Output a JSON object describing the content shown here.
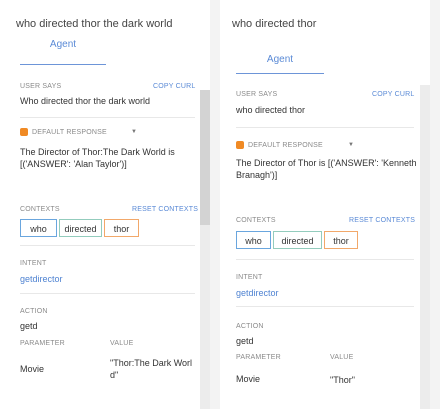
{
  "left": {
    "query": "who directed thor the dark world",
    "tab_label": "Agent",
    "user_says_label": "USER SAYS",
    "copy_curl_label": "COPY CURL",
    "user_says_value": "Who directed thor the dark world",
    "default_response_label": "DEFAULT RESPONSE",
    "response_line1": "The Director of Thor:The Dark World is",
    "response_line2": "[('ANSWER': 'Alan Taylor')]",
    "contexts_label": "CONTEXTS",
    "reset_contexts_label": "RESET CONTEXTS",
    "contexts": [
      "who",
      "directed",
      "thor"
    ],
    "intent_label": "INTENT",
    "intent_value": "getdirector",
    "action_label": "ACTION",
    "action_value": "getd",
    "parameter_header": "PARAMETER",
    "value_header": "VALUE",
    "parameter_name": "Movie",
    "parameter_value_line1": "\"Thor:The Dark Worl",
    "parameter_value_line2": "d\""
  },
  "right": {
    "query": "who directed thor",
    "tab_label": "Agent",
    "user_says_label": "USER SAYS",
    "copy_curl_label": "COPY CURL",
    "user_says_value": "who directed thor",
    "default_response_label": "DEFAULT RESPONSE",
    "response_line1": "The Director of Thor is [('ANSWER': 'Kenneth",
    "response_line2": "Branagh')]",
    "contexts_label": "CONTEXTS",
    "reset_contexts_label": "RESET CONTEXTS",
    "contexts": [
      "who",
      "directed",
      "thor"
    ],
    "intent_label": "INTENT",
    "intent_value": "getdirector",
    "action_label": "ACTION",
    "action_value": "getd",
    "parameter_header": "PARAMETER",
    "value_header": "VALUE",
    "parameter_name": "Movie",
    "parameter_value": "\"Thor\""
  },
  "icons": {
    "default_response": "orange-square-icon",
    "dropdown": "chevron-down-icon"
  },
  "colors": {
    "accent_blue": "#5a8ad6",
    "response_orange": "#f08a24",
    "chip_blue": "#6aa6de",
    "chip_green": "#93ccbd",
    "chip_orange": "#f2a86a"
  }
}
